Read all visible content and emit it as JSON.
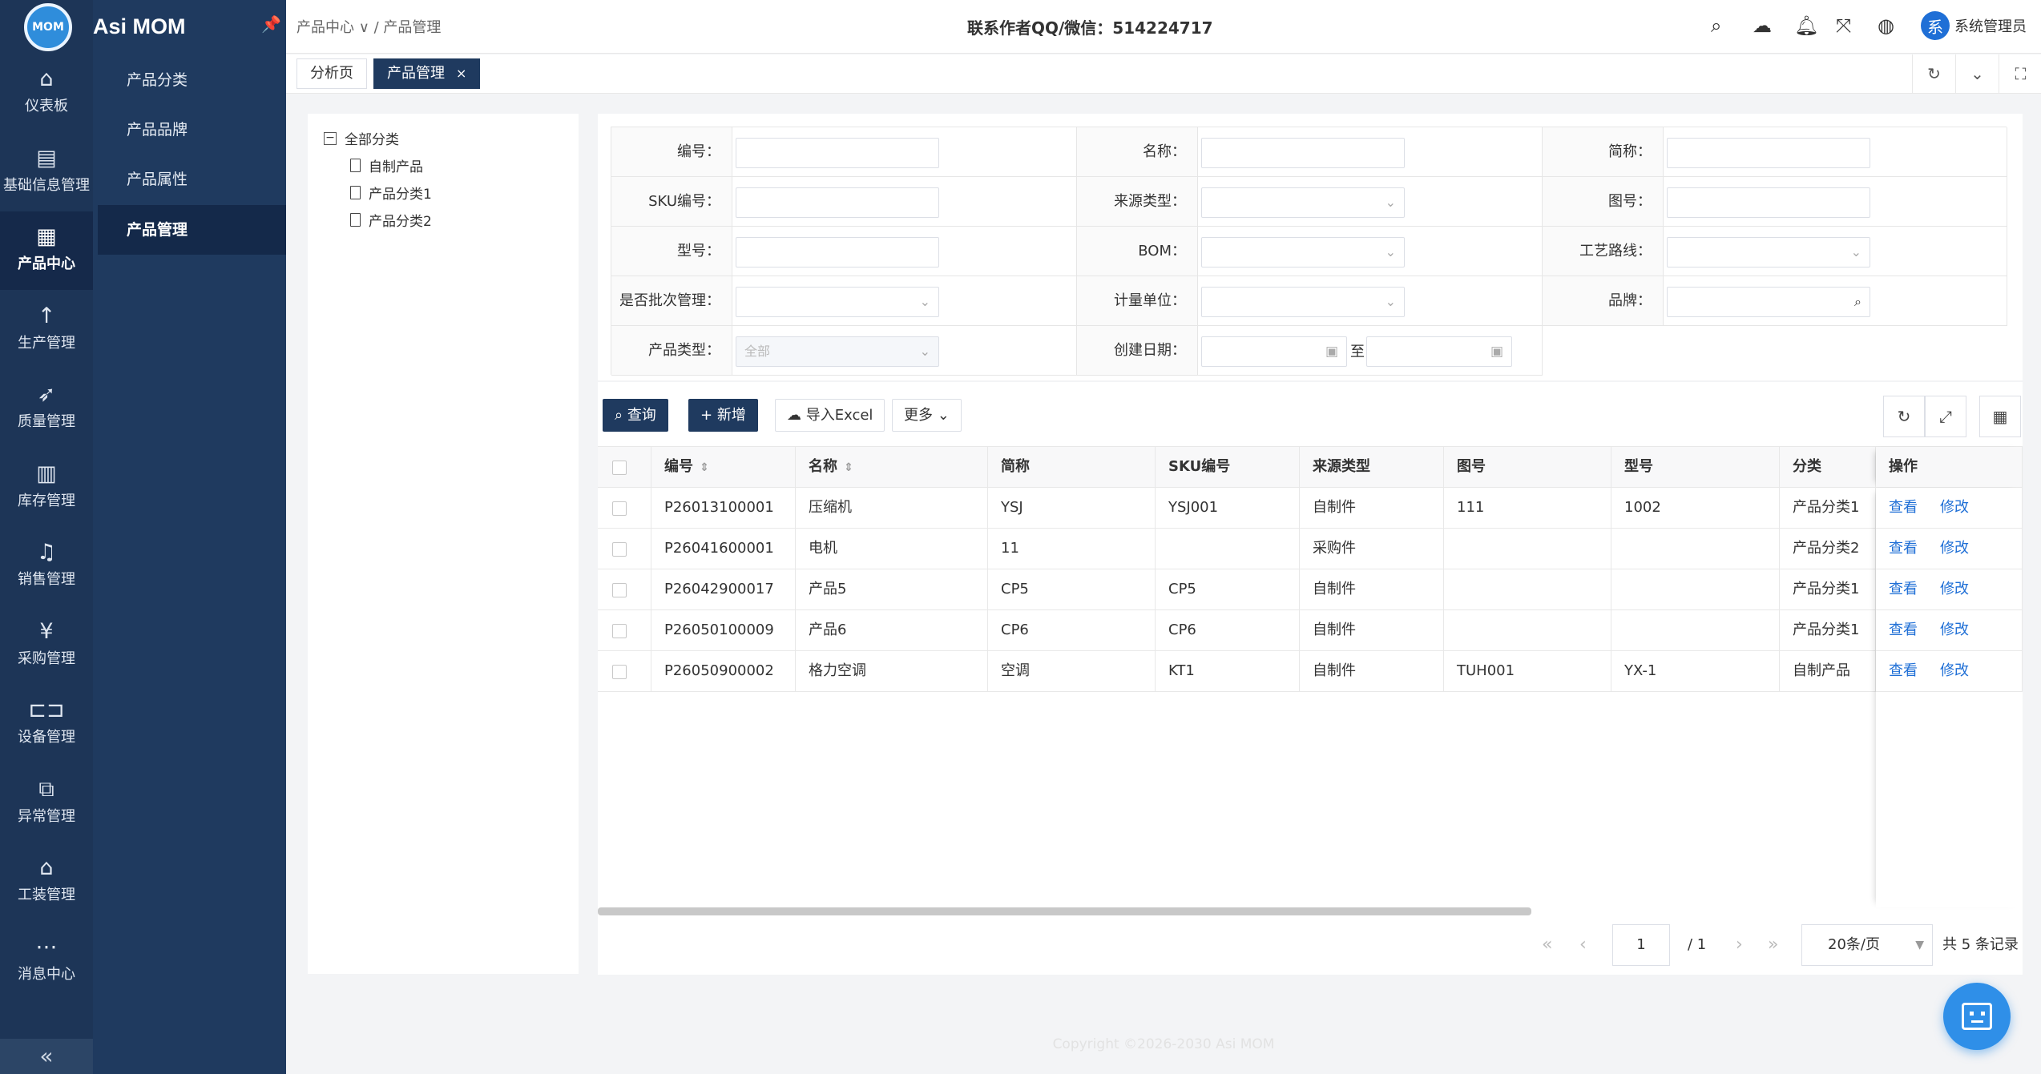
{
  "app": {
    "logo_text": "MOM",
    "title": "Asi MOM"
  },
  "rail": {
    "items": [
      {
        "label": "仪表板",
        "icon": "home-icon",
        "glyph": "⌂"
      },
      {
        "label": "基础信息管理",
        "icon": "document-icon",
        "glyph": "▤"
      },
      {
        "label": "产品中心",
        "icon": "grid-icon",
        "glyph": "▦"
      },
      {
        "label": "生产管理",
        "icon": "arrow-up-icon",
        "glyph": "↑"
      },
      {
        "label": "质量管理",
        "icon": "rocket-icon",
        "glyph": "➶"
      },
      {
        "label": "库存管理",
        "icon": "warehouse-icon",
        "glyph": "▥"
      },
      {
        "label": "销售管理",
        "icon": "bell-icon",
        "glyph": "♫"
      },
      {
        "label": "采购管理",
        "icon": "yen-icon",
        "glyph": "¥"
      },
      {
        "label": "设备管理",
        "icon": "device-icon",
        "glyph": "⊏⊐"
      },
      {
        "label": "异常管理",
        "icon": "hierarchy-icon",
        "glyph": "⧉"
      },
      {
        "label": "工装管理",
        "icon": "bank-icon",
        "glyph": "⌂"
      },
      {
        "label": "消息中心",
        "icon": "message-icon",
        "glyph": "⋯"
      }
    ],
    "active": "产品中心",
    "collapse": "«"
  },
  "submenu": {
    "items": [
      "产品分类",
      "产品品牌",
      "产品属性",
      "产品管理"
    ],
    "active": "产品管理"
  },
  "header": {
    "breadcrumb": "产品中心 ∨ / 产品管理",
    "contact": "联系作者QQ/微信：514224717",
    "user_avatar": "系",
    "user_name": "系统管理员"
  },
  "tabs": [
    {
      "label": "分析页",
      "active": false
    },
    {
      "label": "产品管理",
      "active": true,
      "close": "×"
    }
  ],
  "tree": {
    "root": "全部分类",
    "root_toggle": "−",
    "children": [
      "自制产品",
      "产品分类1",
      "产品分类2"
    ]
  },
  "form": {
    "labels": {
      "code": "编号：",
      "name": "名称：",
      "short": "简称：",
      "sku": "SKU编号：",
      "source": "来源类型：",
      "drawing": "图号：",
      "model": "型号：",
      "bom": "BOM：",
      "route": "工艺路线：",
      "batch": "是否批次管理：",
      "unit": "计量单位：",
      "brand": "品牌：",
      "ptype": "产品类型：",
      "created": "创建日期："
    },
    "ptype_placeholder": "全部",
    "date_to": "至"
  },
  "toolbar": {
    "query": "查询",
    "add": "新增",
    "import": "导入Excel",
    "more": "更多"
  },
  "table": {
    "columns": [
      "编号",
      "名称",
      "简称",
      "SKU编号",
      "来源类型",
      "图号",
      "型号",
      "分类",
      "操作"
    ],
    "rows": [
      {
        "code": "P26013100001",
        "name": "压缩机",
        "short": "YSJ",
        "sku": "YSJ001",
        "source": "自制件",
        "drawing": "111",
        "model": "1002",
        "category": "产品分类1"
      },
      {
        "code": "P26041600001",
        "name": "电机",
        "short": "11",
        "sku": "",
        "source": "采购件",
        "drawing": "",
        "model": "",
        "category": "产品分类2"
      },
      {
        "code": "P26042900017",
        "name": "产品5",
        "short": "CP5",
        "sku": "CP5",
        "source": "自制件",
        "drawing": "",
        "model": "",
        "category": "产品分类1"
      },
      {
        "code": "P26050100009",
        "name": "产品6",
        "short": "CP6",
        "sku": "CP6",
        "source": "自制件",
        "drawing": "",
        "model": "",
        "category": "产品分类1"
      },
      {
        "code": "P26050900002",
        "name": "格力空调",
        "short": "空调",
        "sku": "KT1",
        "source": "自制件",
        "drawing": "TUH001",
        "model": "YX-1",
        "category": "自制产品"
      }
    ],
    "view_label": "查看",
    "edit_label": "修改"
  },
  "pagination": {
    "page": "1",
    "total_pages": "/ 1",
    "page_size": "20条/页",
    "total": "共 5 条记录"
  },
  "footer": "Copyright ©2026-2030 Asi MOM",
  "colors": {
    "sidebar": "#1d3557",
    "accent": "#1f3a5f",
    "link": "#1f6fd6"
  }
}
